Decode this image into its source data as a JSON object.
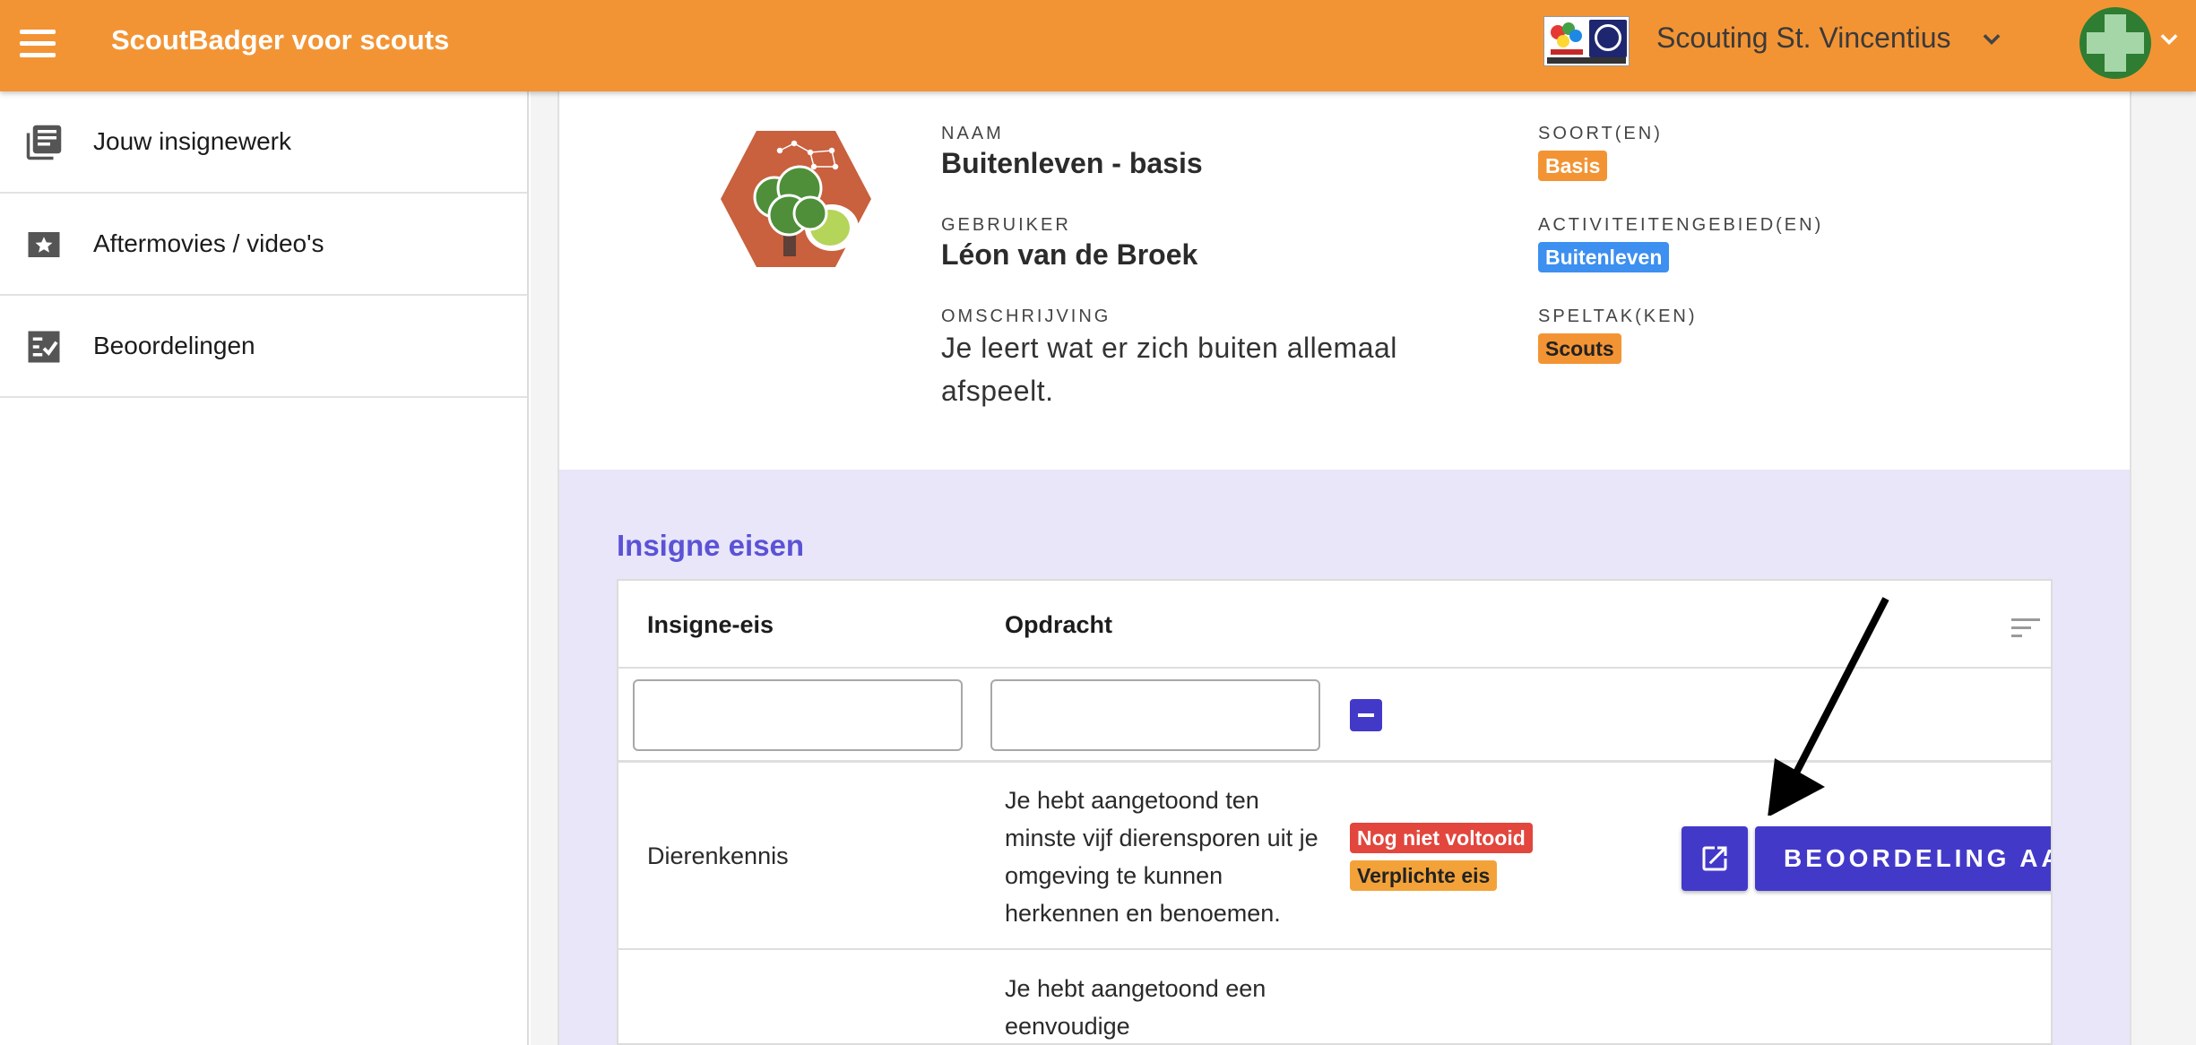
{
  "topbar": {
    "app_title": "ScoutBadger voor scouts",
    "org_name": "Scouting St. Vincentius",
    "org_logo_text": "Scouting St. Vincentius Brunssum",
    "brand_color": "#f39434"
  },
  "sidebar": {
    "items": [
      {
        "label": "Jouw insignewerk",
        "icon": "library-books-icon"
      },
      {
        "label": "Aftermovies / video's",
        "icon": "star-video-icon"
      },
      {
        "label": "Beoordelingen",
        "icon": "checklist-icon"
      }
    ]
  },
  "badge": {
    "naam_label": "NAAM",
    "naam": "Buitenleven - basis",
    "gebruiker_label": "GEBRUIKER",
    "gebruiker": "Léon van de Broek",
    "omschrijving_label": "OMSCHRIJVING",
    "omschrijving": "Je leert wat er zich buiten allemaal afspeelt.",
    "soort_label": "SOORT(EN)",
    "soort": "Basis",
    "gebied_label": "ACTIVITEITENGEBIED(EN)",
    "gebied": "Buitenleven",
    "speltak_label": "SPELTAK(KEN)",
    "speltak": "Scouts"
  },
  "requirements": {
    "title": "Insigne eisen",
    "columns": [
      "Insigne-eis",
      "Opdracht"
    ],
    "filter_placeholders": [
      "",
      ""
    ],
    "rows": [
      {
        "eis": "Dierenkennis",
        "opdracht": "Je hebt aangetoond ten minste vijf dierensporen uit je omgeving te kunnen herkennen en benoemen.",
        "status": "Nog niet voltooid",
        "type": "Verplichte eis",
        "action": "BEOORDELING AA"
      },
      {
        "eis": "",
        "opdracht": "Je hebt aangetoond een eenvoudige",
        "status": "",
        "type": "",
        "action": ""
      }
    ]
  },
  "colors": {
    "accent_purple": "#4339c9",
    "section_bg": "#e8e6f8",
    "chip_blue": "#3d8ff0",
    "chip_red": "#e2463d"
  }
}
